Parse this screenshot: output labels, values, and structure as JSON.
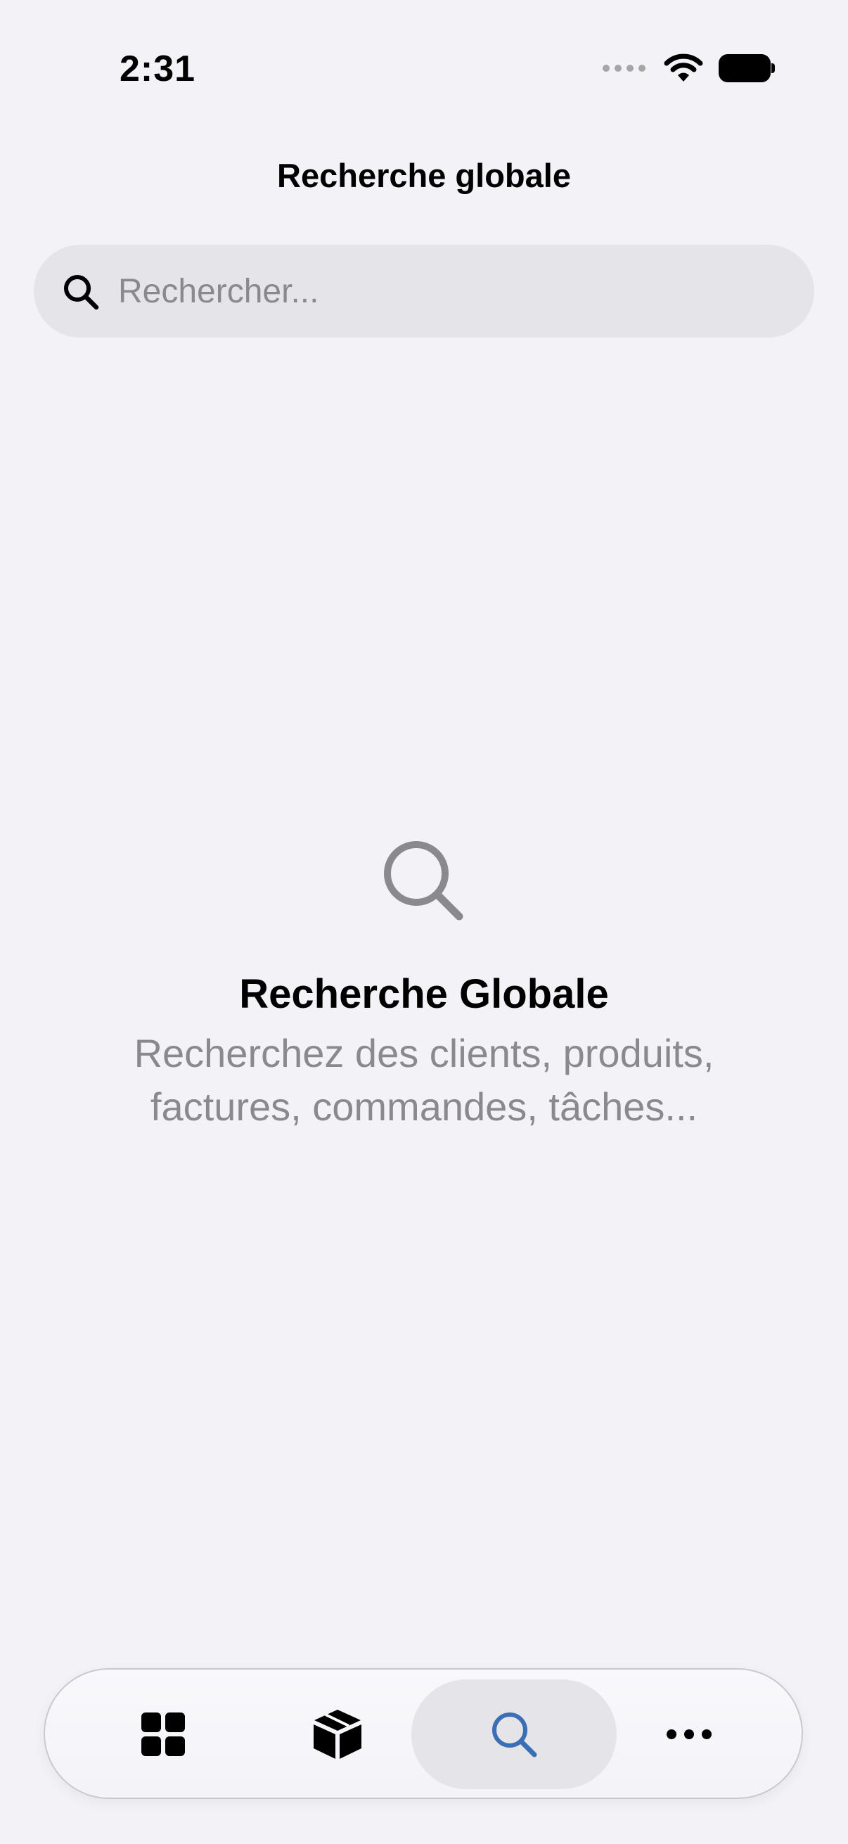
{
  "status_bar": {
    "time": "2:31"
  },
  "nav": {
    "title": "Recherche globale"
  },
  "search": {
    "placeholder": "Rechercher...",
    "value": ""
  },
  "empty_state": {
    "icon": "magnifying-glass-icon",
    "title": "Recherche Globale",
    "subtitle": "Recherchez des clients, produits, factures, commandes, tâches..."
  },
  "tab_bar": {
    "items": [
      {
        "icon": "grid-icon",
        "active": false
      },
      {
        "icon": "box-icon",
        "active": false
      },
      {
        "icon": "search-icon",
        "active": true
      },
      {
        "icon": "more-icon",
        "active": false
      }
    ],
    "active_color": "#3a6fb5"
  },
  "colors": {
    "background": "#f2f2f7",
    "search_field": "#e4e4e9",
    "secondary_text": "#8a8a8e"
  }
}
